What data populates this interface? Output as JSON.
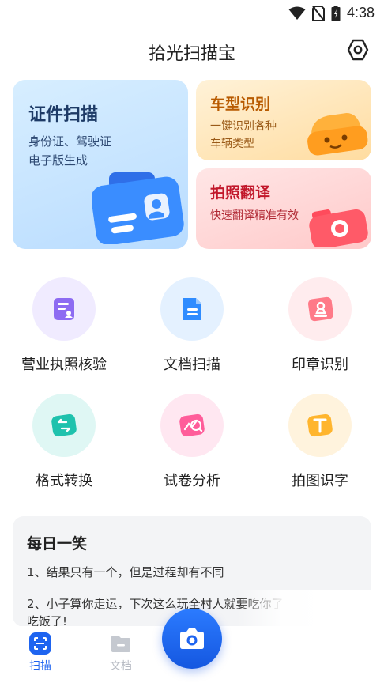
{
  "status_bar": {
    "time": "4:38"
  },
  "header": {
    "title": "拾光扫描宝"
  },
  "feature_cards": {
    "id_scan": {
      "title": "证件扫描",
      "desc_line1": "身份证、驾驶证",
      "desc_line2": "电子版生成"
    },
    "car_recog": {
      "title": "车型识别",
      "desc_line1": "一键识别各种",
      "desc_line2": "车辆类型"
    },
    "photo_translate": {
      "title": "拍照翻译",
      "desc": "快速翻译精准有效"
    }
  },
  "tools": [
    {
      "label": "营业执照核验",
      "icon": "business-license-icon"
    },
    {
      "label": "文档扫描",
      "icon": "document-icon"
    },
    {
      "label": "印章识别",
      "icon": "stamp-icon"
    },
    {
      "label": "格式转换",
      "icon": "convert-icon"
    },
    {
      "label": "试卷分析",
      "icon": "exam-analysis-icon"
    },
    {
      "label": "拍图识字",
      "icon": "text-recognition-icon"
    }
  ],
  "daily_joke": {
    "title": "每日一笑",
    "lines": [
      "1、结果只有一个，但是过程却有不同",
      "2、小子算你走运，下次这么玩全村人就要吃你了",
      "吃饭了!"
    ]
  },
  "bottom_nav": {
    "scan_label": "扫描",
    "docs_label": "文档"
  },
  "colors": {
    "accent": "#1e64f0",
    "nav_inactive": "#b8bcc4"
  }
}
